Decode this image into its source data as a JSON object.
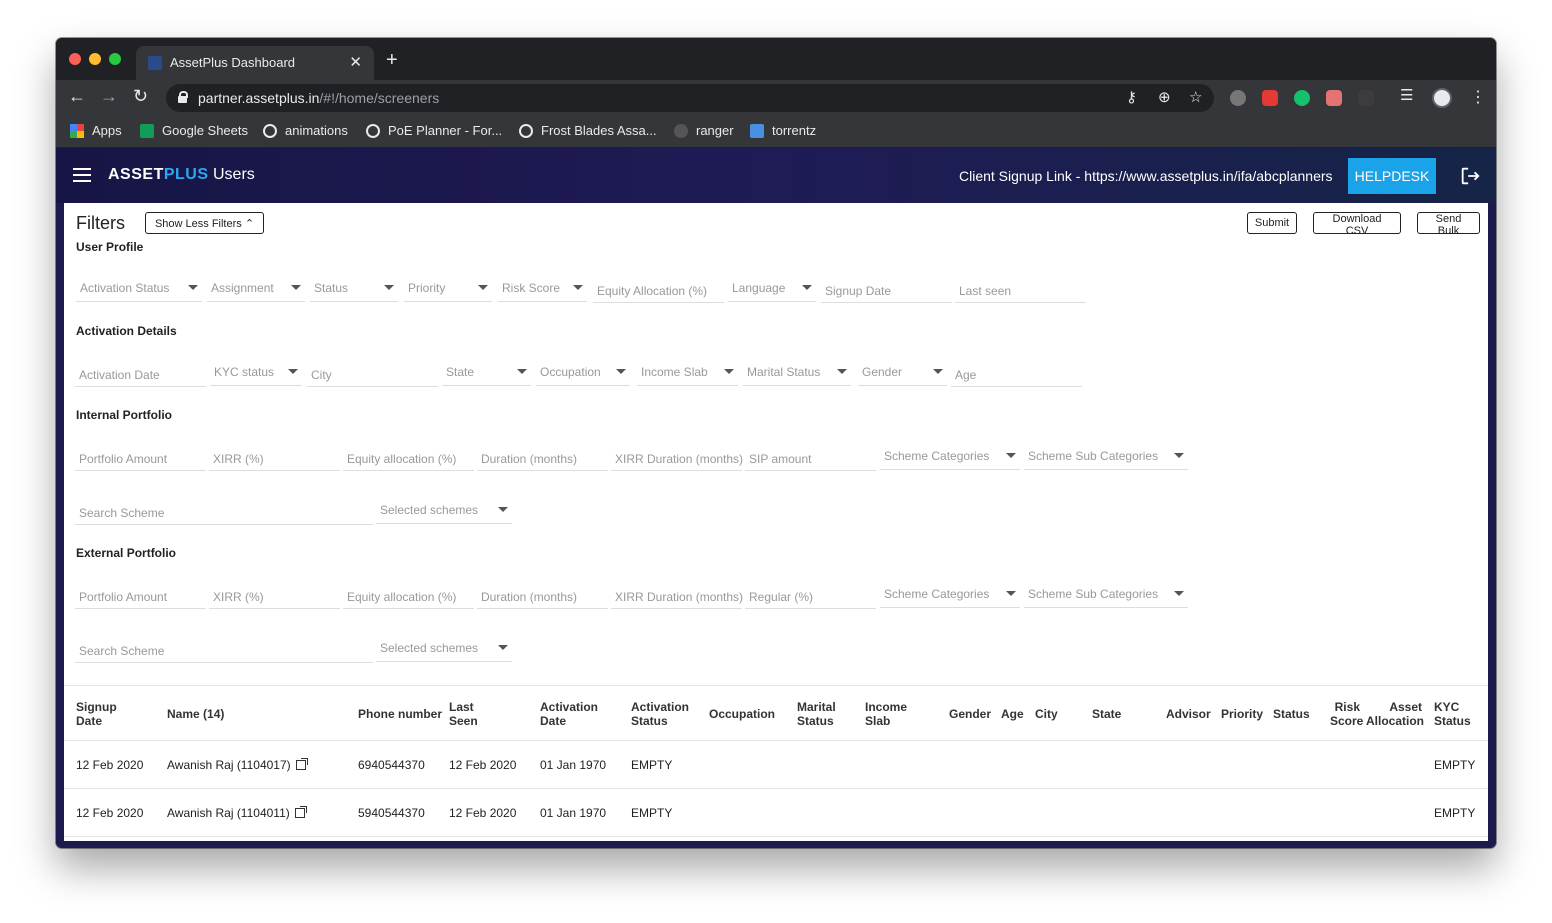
{
  "browser": {
    "tab_title": "AssetPlus Dashboard",
    "url_host": "partner.assetplus.in",
    "url_path": "/#!/home/screeners",
    "bookmarks": [
      "Apps",
      "Google Sheets",
      "animations",
      "PoE Planner - For...",
      "Frost Blades Assa...",
      "ranger",
      "torrentz"
    ]
  },
  "appbar": {
    "logo_part1": "ASSET",
    "logo_part2": "PLUS",
    "title": "Users",
    "signup_link": "Client Signup Link - https://www.assetplus.in/ifa/abcplanners",
    "helpdesk": "HELPDESK"
  },
  "filters": {
    "title": "Filters",
    "toggle_label": "Show Less Filters",
    "submit": "Submit",
    "download_csv": "Download CSV",
    "send_bulk": "Send Bulk",
    "sections": {
      "user_profile": {
        "title": "User Profile",
        "fields": [
          "Activation Status",
          "Assignment",
          "Status",
          "Priority",
          "Risk Score",
          "Equity Allocation (%)",
          "Language",
          "Signup Date",
          "Last seen"
        ]
      },
      "activation_details": {
        "title": "Activation Details",
        "fields": [
          "Activation Date",
          "KYC status",
          "City",
          "State",
          "Occupation",
          "Income Slab",
          "Marital Status",
          "Gender",
          "Age"
        ]
      },
      "internal_portfolio": {
        "title": "Internal Portfolio",
        "fields": [
          "Portfolio Amount",
          "XIRR (%)",
          "Equity allocation (%)",
          "Duration (months)",
          "XIRR Duration (months)",
          "SIP amount",
          "Scheme Categories",
          "Scheme Sub Categories"
        ],
        "search_scheme": "Search Scheme",
        "selected_schemes": "Selected schemes"
      },
      "external_portfolio": {
        "title": "External Portfolio",
        "fields": [
          "Portfolio Amount",
          "XIRR (%)",
          "Equity allocation (%)",
          "Duration (months)",
          "XIRR Duration (months)",
          "Regular (%)",
          "Scheme Categories",
          "Scheme Sub Categories"
        ],
        "search_scheme": "Search Scheme",
        "selected_schemes": "Selected schemes"
      }
    }
  },
  "table": {
    "columns": {
      "signup_date": [
        "Signup",
        "Date"
      ],
      "name": "Name (14)",
      "phone": "Phone number",
      "last_seen": [
        "Last",
        "Seen"
      ],
      "activation_date": [
        "Activation",
        "Date"
      ],
      "activation_status": [
        "Activation",
        "Status"
      ],
      "occupation": "Occupation",
      "marital_status": [
        "Marital",
        "Status"
      ],
      "income_slab": [
        "Income",
        "Slab"
      ],
      "gender": "Gender",
      "age": "Age",
      "city": "City",
      "state": "State",
      "advisor": "Advisor",
      "priority": "Priority",
      "status": "Status",
      "risk_score": [
        "Risk",
        "Score"
      ],
      "asset_allocation": [
        "Asset",
        "Allocation"
      ],
      "kyc_status": [
        "KYC",
        "Status"
      ]
    },
    "rows": [
      {
        "signup_date": "12 Feb 2020",
        "name": "Awanish Raj (1104017)",
        "phone": "6940544370",
        "last_seen": "12 Feb 2020",
        "activation_date": "01 Jan 1970",
        "activation_status": "EMPTY",
        "kyc_status": "EMPTY"
      },
      {
        "signup_date": "12 Feb 2020",
        "name": "Awanish Raj (1104011)",
        "phone": "5940544370",
        "last_seen": "12 Feb 2020",
        "activation_date": "01 Jan 1970",
        "activation_status": "EMPTY",
        "kyc_status": "EMPTY"
      }
    ]
  },
  "colors": {
    "appbar": "#1d1b4d",
    "accent": "#1aa3e8"
  }
}
